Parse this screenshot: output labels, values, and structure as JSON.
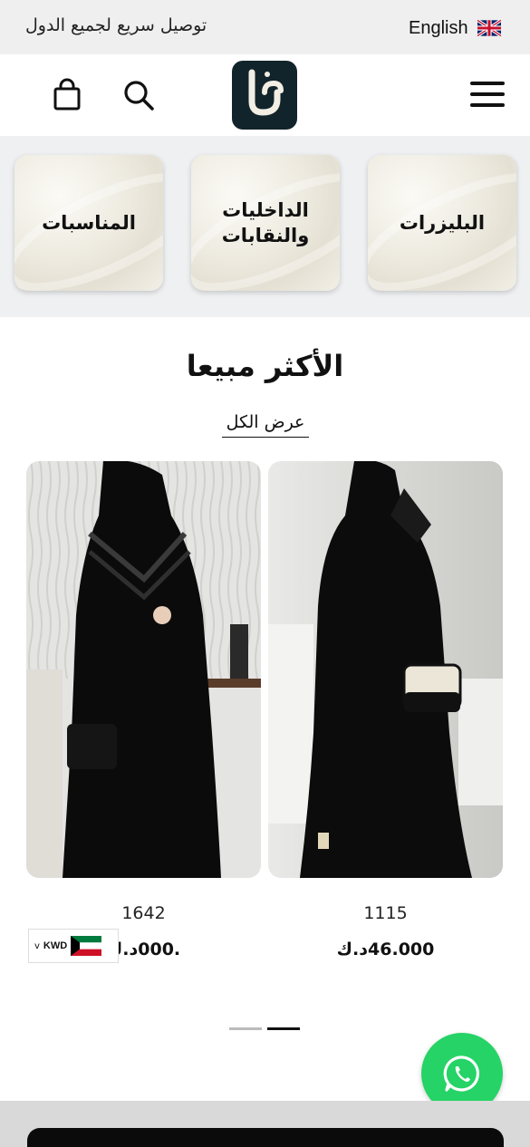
{
  "topbar": {
    "language_label": "English",
    "language_flag": "uk-flag-icon",
    "announcement": "توصيل سريع لجميع الدول",
    "background": "#efefef"
  },
  "header": {
    "logo_text": "لـو",
    "logo_bg": "#12242b",
    "icons": [
      "cart-icon",
      "search-icon",
      "menu-icon"
    ]
  },
  "categories": [
    {
      "label": "البليزرات"
    },
    {
      "label": "الداخليات والنقابات"
    },
    {
      "label": "المناسبات"
    }
  ],
  "best_sellers": {
    "title": "الأكثر مبيعا",
    "view_all": "عرض الكل",
    "products": [
      {
        "name": "1115",
        "price": "46.000د.ك"
      },
      {
        "name": "1642",
        "price": ".000د.ك"
      }
    ]
  },
  "currency": {
    "code": "KWD",
    "flag": "kuwait-flag-icon",
    "chevron": "v"
  },
  "carousel": {
    "active_page": 2,
    "pages": 2
  },
  "whatsapp": {
    "icon": "whatsapp-icon",
    "color": "#25d366"
  }
}
